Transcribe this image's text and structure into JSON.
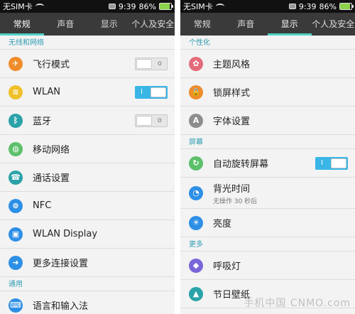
{
  "left": {
    "status": {
      "carrier": "无SIM卡",
      "time": "9:39",
      "battery": "86%",
      "battery_level": 0.86
    },
    "tabs": [
      {
        "label": "常规",
        "active": true
      },
      {
        "label": "声音",
        "active": false
      },
      {
        "label": "显示",
        "active": false
      },
      {
        "label": "个人及安全",
        "active": false
      }
    ],
    "sections": [
      {
        "title": "无线和网络",
        "items": [
          {
            "label": "飞行模式",
            "icon": "airplane-icon",
            "icon_color": "#f08c2a",
            "toggle": "off"
          },
          {
            "label": "WLAN",
            "icon": "wifi-icon",
            "icon_color": "#f0c02a",
            "toggle": "on"
          },
          {
            "label": "蓝牙",
            "icon": "bluetooth-icon",
            "icon_color": "#2aa3a9",
            "toggle": "off"
          },
          {
            "label": "移动网络",
            "icon": "globe-icon",
            "icon_color": "#5cc06a"
          },
          {
            "label": "通话设置",
            "icon": "phone-icon",
            "icon_color": "#2aa3a9"
          },
          {
            "label": "NFC",
            "icon": "nfc-icon",
            "icon_color": "#2d8fe6"
          },
          {
            "label": "WLAN Display",
            "icon": "display-icon",
            "icon_color": "#2d8fe6"
          },
          {
            "label": "更多连接设置",
            "icon": "arrow-icon",
            "icon_color": "#2d8fe6"
          }
        ]
      },
      {
        "title": "通用",
        "items": [
          {
            "label": "语言和输入法",
            "icon": "keyboard-icon",
            "icon_color": "#2d8fe6"
          }
        ]
      }
    ]
  },
  "right": {
    "status": {
      "carrier": "无SIM卡",
      "time": "9:39",
      "battery": "86%",
      "battery_level": 0.86
    },
    "tabs": [
      {
        "label": "常规",
        "active": false
      },
      {
        "label": "声音",
        "active": false
      },
      {
        "label": "显示",
        "active": true
      },
      {
        "label": "个人及安全",
        "active": false
      }
    ],
    "sections": [
      {
        "title": "个性化",
        "items": [
          {
            "label": "主题风格",
            "icon": "flower-icon",
            "icon_color": "#e46b7a"
          },
          {
            "label": "锁屏样式",
            "icon": "lock-icon",
            "icon_color": "#f08c2a"
          },
          {
            "label": "字体设置",
            "icon": "font-icon",
            "icon_color": "#8d8d8d"
          }
        ]
      },
      {
        "title": "屏幕",
        "items": [
          {
            "label": "自动旋转屏幕",
            "icon": "rotate-icon",
            "icon_color": "#5cc06a",
            "toggle": "on"
          },
          {
            "label": "背光时间",
            "sub": "无操作 30 秒后",
            "icon": "timer-icon",
            "icon_color": "#2d8fe6"
          },
          {
            "label": "亮度",
            "icon": "brightness-icon",
            "icon_color": "#2d8fe6"
          }
        ]
      },
      {
        "title": "更多",
        "items": [
          {
            "label": "呼吸灯",
            "icon": "breathing-light-icon",
            "icon_color": "#7a65d9"
          },
          {
            "label": "节日壁纸",
            "icon": "tree-icon",
            "icon_color": "#2aa3a9"
          }
        ]
      }
    ],
    "watermark": "手机中国 CNMO.com"
  }
}
